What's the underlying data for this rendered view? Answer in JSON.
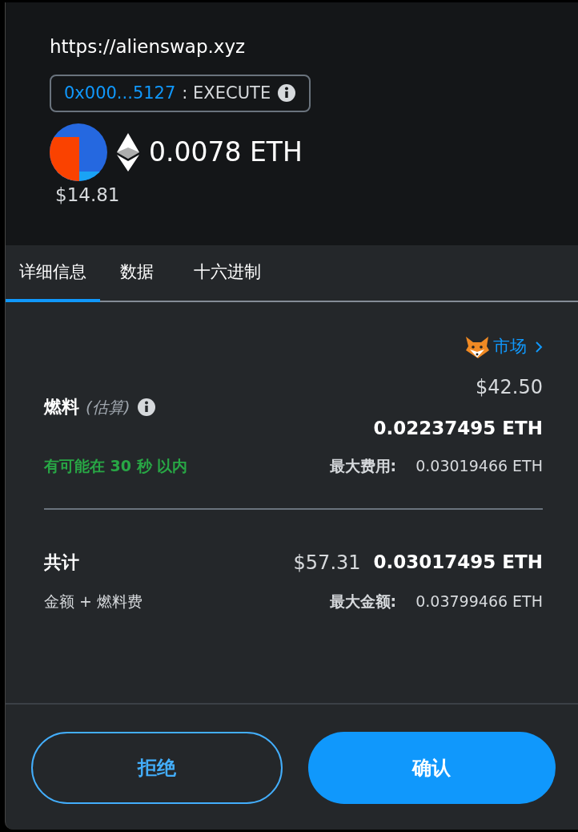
{
  "origin": "https://alienswap.xyz",
  "contract": {
    "address": "0x000...5127",
    "method": ": EXECUTE"
  },
  "amount": {
    "value": "0.0078 ETH",
    "fiat": "$14.81"
  },
  "tabs": [
    {
      "label": "详细信息",
      "selected": true
    },
    {
      "label": "数据",
      "selected": false
    },
    {
      "label": "十六进制",
      "selected": false
    }
  ],
  "market": {
    "label": "市场"
  },
  "gas": {
    "label": "燃料",
    "note": "(估算)",
    "fiat": "$42.50",
    "eth": "0.02237495 ETH",
    "eta": "有可能在 30 秒 以内",
    "max_label": "最大费用:",
    "max_value": "0.03019466 ETH"
  },
  "total": {
    "label": "共计",
    "fiat": "$57.31",
    "eth": "0.03017495 ETH",
    "sublabel": "金额 + 燃料费",
    "max_label": "最大金额:",
    "max_value": "0.03799466 ETH"
  },
  "buttons": [
    {
      "label": "拒绝",
      "kind": "secondary"
    },
    {
      "label": "确认",
      "kind": "primary"
    }
  ]
}
